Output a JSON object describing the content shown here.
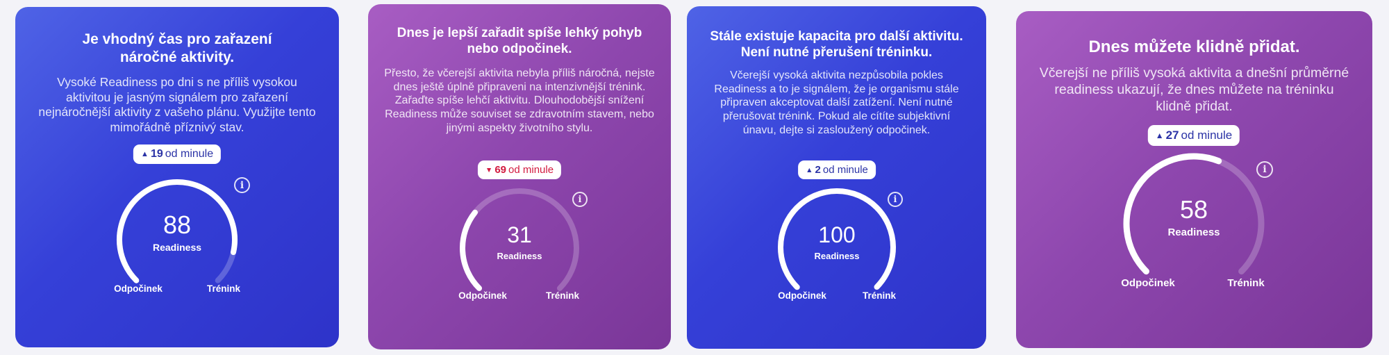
{
  "cards": [
    {
      "title": "Je vhodný čas pro zařazení náročné aktivity.",
      "description": "Vysoké Readiness po dni s ne příliš vysokou aktivitou je jasným signálem pro zařazení nejnáročnější aktivity z vašeho plánu. Využijte tento mimořádně příznivý stav.",
      "change": {
        "direction": "up",
        "arrow": "▲",
        "value": "19",
        "text": "od minule"
      },
      "score": "88",
      "score_label": "Readiness",
      "level": 0.88,
      "left_label": "Odpočinek",
      "right_label": "Trénink",
      "info_icon": "i",
      "theme": "blue"
    },
    {
      "title": "Dnes je lepší zařadit spíše lehký pohyb nebo odpočinek.",
      "description": "Přesto, že včerejší aktivita nebyla příliš náročná, nejste dnes ještě úplně připraveni na intenzivnější trénink. Zařaďte spíše lehčí aktivitu. Dlouhodobější snížení Readiness může souviset se zdravotním stavem, nebo jinými aspekty životního stylu.",
      "change": {
        "direction": "down",
        "arrow": "▼",
        "value": "69",
        "text": "od minule"
      },
      "score": "31",
      "score_label": "Readiness",
      "level": 0.31,
      "left_label": "Odpočinek",
      "right_label": "Trénink",
      "info_icon": "i",
      "theme": "purple"
    },
    {
      "title": "Stále existuje kapacita pro další aktivitu. Není nutné přerušení tréninku.",
      "description": "Včerejší vysoká aktivita nezpůsobila pokles Readiness a to je signálem, že je organismu stále připraven akceptovat další zatížení. Není nutné přerušovat trénink. Pokud ale cítíte subjektivní únavu, dejte si zasloužený odpočinek.",
      "change": {
        "direction": "up",
        "arrow": "▲",
        "value": "2",
        "text": "od minule"
      },
      "score": "100",
      "score_label": "Readiness",
      "level": 1.0,
      "left_label": "Odpočinek",
      "right_label": "Trénink",
      "info_icon": "i",
      "theme": "blue"
    },
    {
      "title": "Dnes můžete klidně přidat.",
      "description": "Včerejší ne příliš vysoká aktivita a dnešní průměrné readiness ukazují, že dnes můžete na tréninku klidně přidat.",
      "change": {
        "direction": "up",
        "arrow": "▲",
        "value": "27",
        "text": "od minule"
      },
      "score": "58",
      "score_label": "Readiness",
      "level": 0.58,
      "left_label": "Odpočinek",
      "right_label": "Trénink",
      "info_icon": "i",
      "theme": "purple"
    }
  ]
}
